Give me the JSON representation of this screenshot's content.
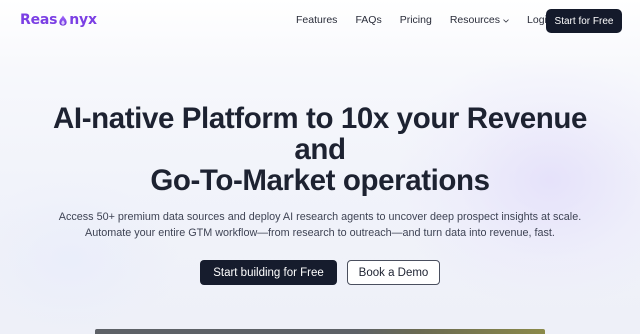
{
  "header": {
    "logo": {
      "prefix": "Reas",
      "suffix": "nyx"
    },
    "nav": [
      {
        "label": "Features"
      },
      {
        "label": "FAQs"
      },
      {
        "label": "Pricing"
      },
      {
        "label": "Resources"
      },
      {
        "label": "Login"
      }
    ],
    "cta_label": "Start for Free"
  },
  "hero": {
    "title_lines": [
      "AI-native Platform to 10x your Revenue",
      "and",
      "Go-To-Market operations"
    ],
    "subtitle_lines": [
      "Access 50+ premium data sources and deploy AI research agents to uncover deep prospect insights at scale.",
      "Automate your entire GTM workflow—from research to outreach—and turn data into revenue, fast."
    ],
    "primary_button": "Start building for Free",
    "secondary_button": "Book a Demo"
  },
  "colors": {
    "brand": "#7b3fe4",
    "dark_button": "#141a2b",
    "heading": "#1d2231"
  },
  "icons": {
    "logo_mark": "flame-drop-icon",
    "resources_dropdown": "chevron-down-icon"
  }
}
